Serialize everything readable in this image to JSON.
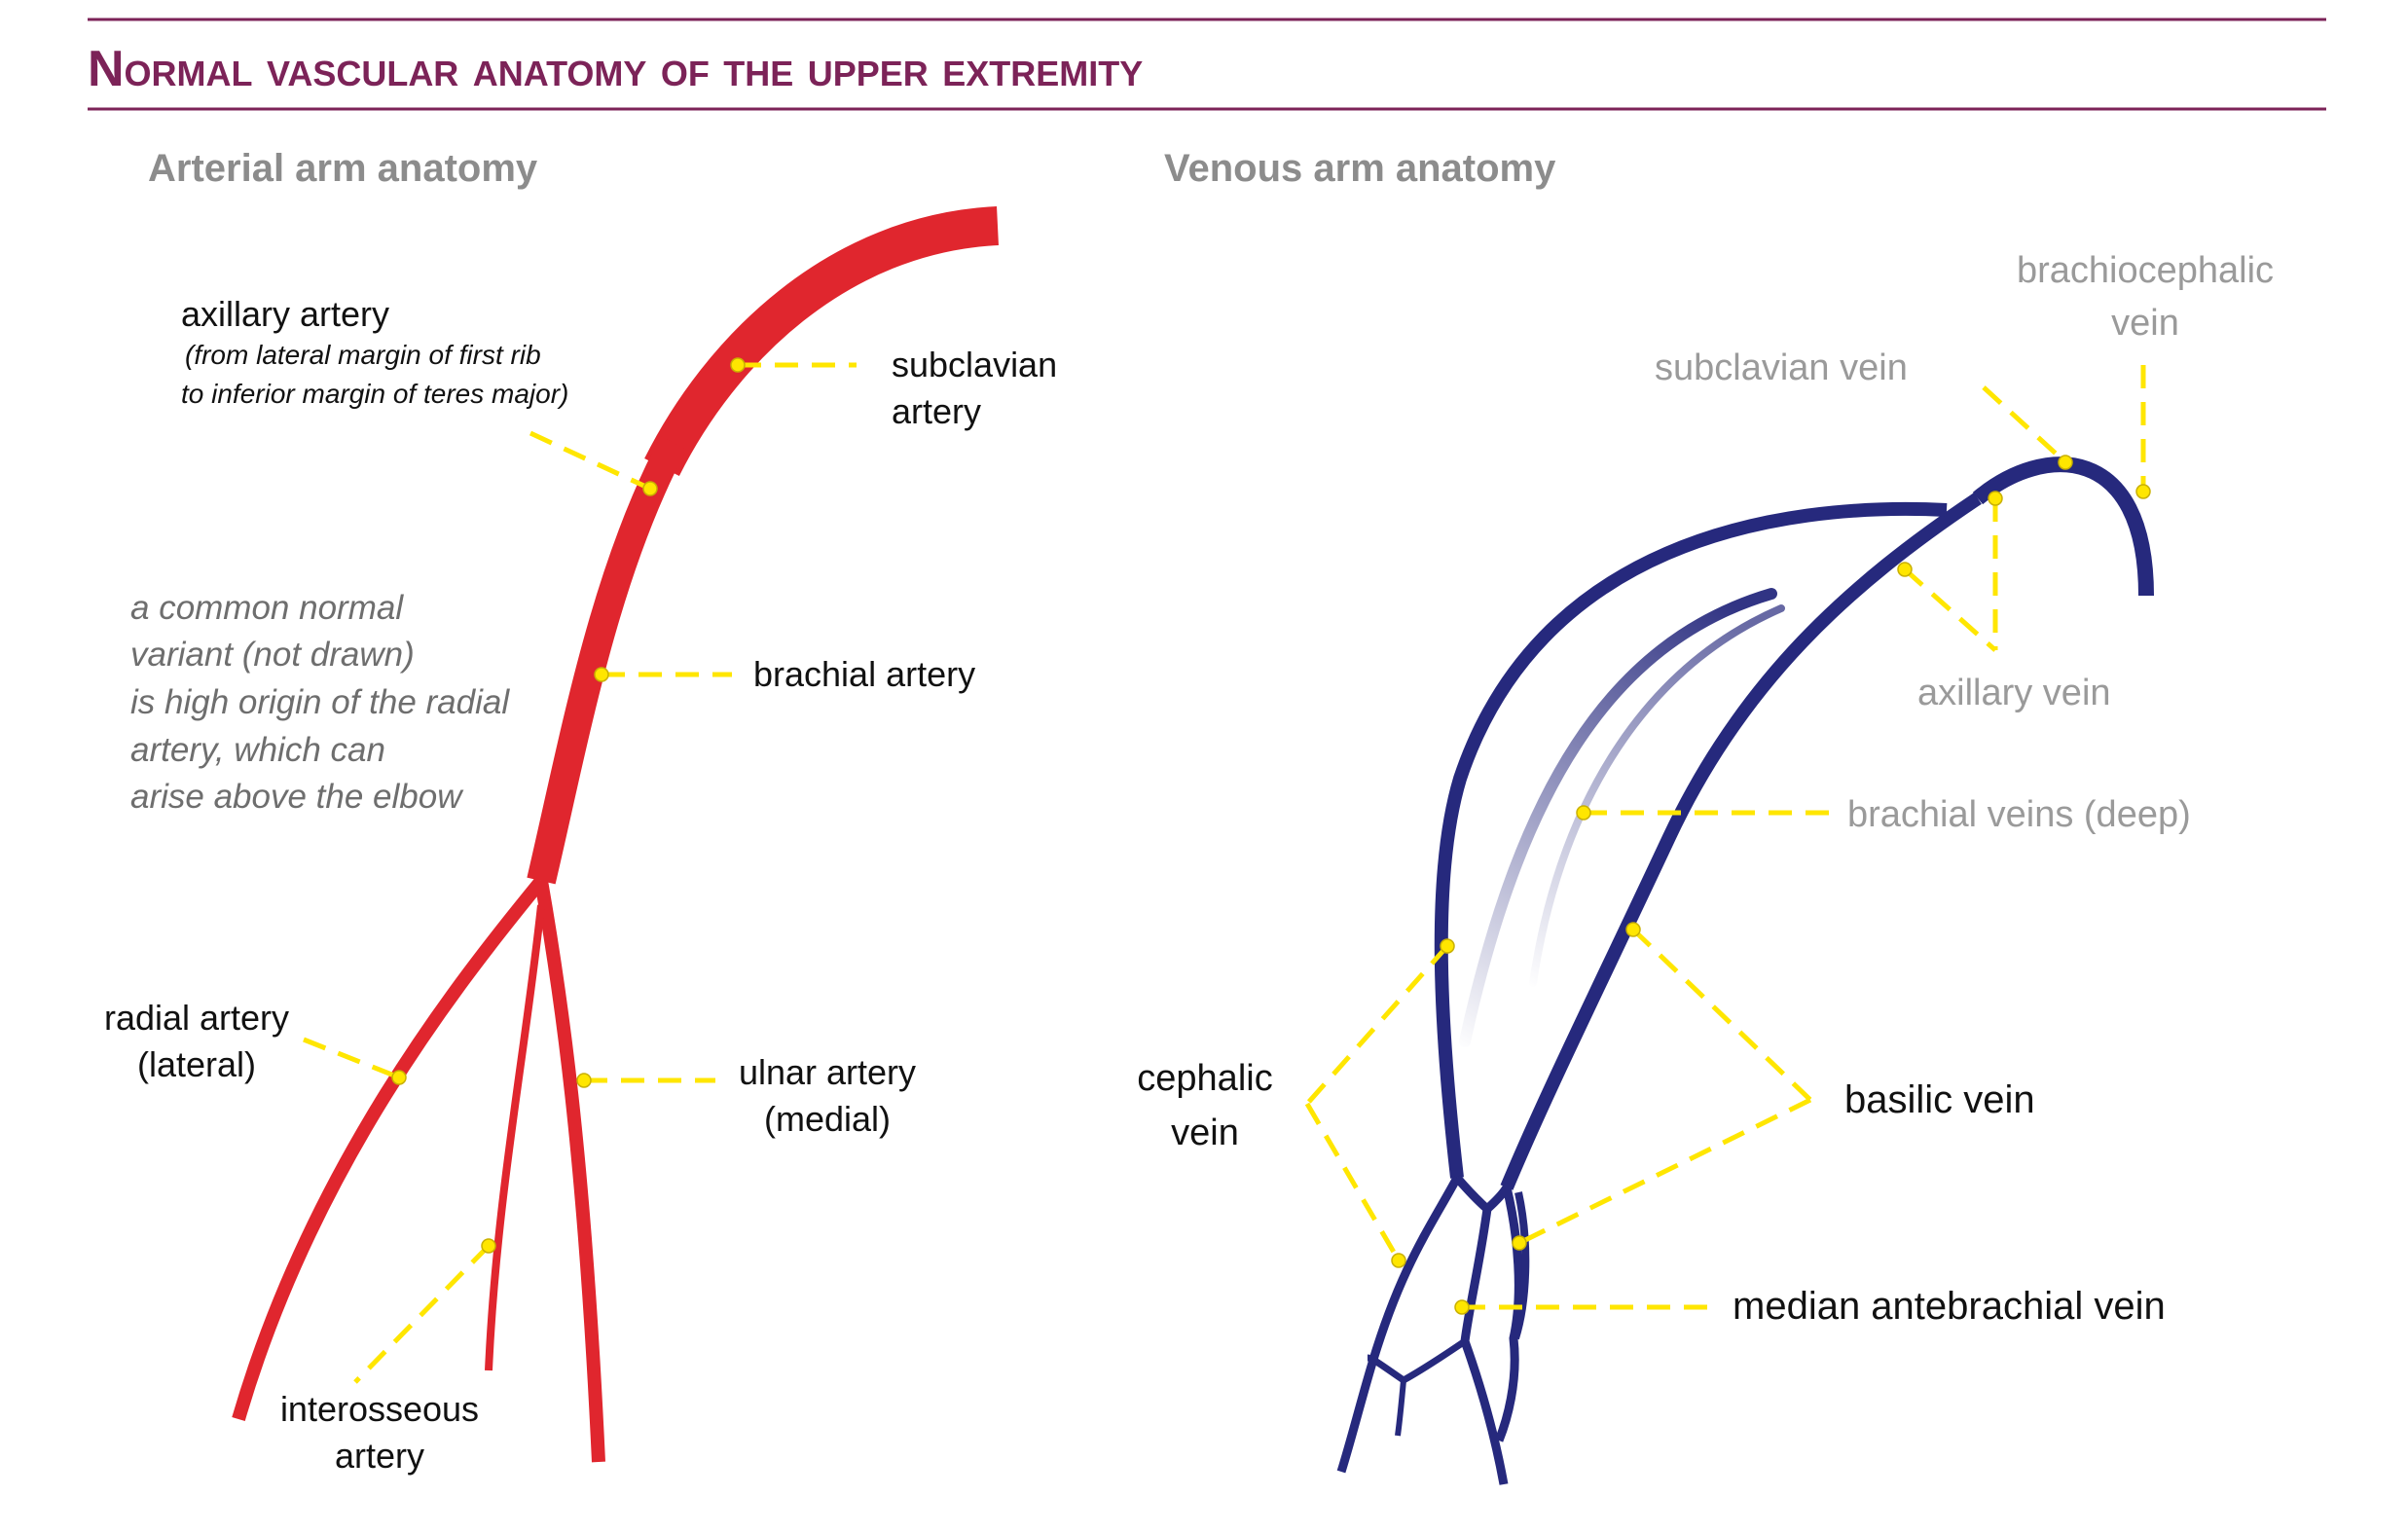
{
  "header": {
    "title": "Normal vascular anatomy of the upper extremity"
  },
  "arterial": {
    "section_title": "Arterial arm anatomy",
    "axillary": {
      "name": "axillary artery",
      "note_line1": "(from lateral margin of first rib",
      "note_line2": "to inferior margin of teres major)"
    },
    "subclavian": {
      "line1": "subclavian",
      "line2": "artery"
    },
    "brachial": "brachial artery",
    "variant_note": [
      "a common normal",
      "variant (not drawn)",
      "is high origin of the radial",
      "artery, which can",
      "arise above the elbow"
    ],
    "radial": {
      "line1": "radial artery",
      "line2": "(lateral)"
    },
    "ulnar": {
      "line1": "ulnar artery",
      "line2": "(medial)"
    },
    "interosseous": {
      "line1": "interosseous",
      "line2": "artery"
    }
  },
  "venous": {
    "section_title": "Venous arm anatomy",
    "brachiocephalic": {
      "line1": "brachiocephalic",
      "line2": "vein"
    },
    "subclavian": "subclavian vein",
    "axillary": "axillary vein",
    "brachial_deep": "brachial veins (deep)",
    "cephalic": {
      "line1": "cephalic",
      "line2": "vein"
    },
    "basilic": "basilic vein",
    "median_antebrachial": "median antebrachial vein"
  },
  "colors": {
    "title": "#7c2358",
    "rule": "#7c2358",
    "artery": "#e0262e",
    "vein": "#26297d",
    "leader": "#ffe600",
    "section_title": "#8c8c8c"
  }
}
